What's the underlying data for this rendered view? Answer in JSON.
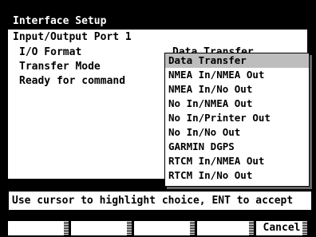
{
  "window": {
    "title": "Interface Setup",
    "port_label": "Input/Output Port 1",
    "options": [
      {
        "label": "I/O Format",
        "value": "Data Transfer"
      },
      {
        "label": "Transfer Mode"
      },
      {
        "label": "Ready for command"
      }
    ]
  },
  "menu": {
    "selected_index": 0,
    "items": [
      "Data Transfer",
      "NMEA In/NMEA Out",
      "NMEA In/No Out",
      "No In/NMEA Out",
      "No In/Printer Out",
      "No In/No Out",
      "GARMIN DGPS",
      "RTCM In/NMEA Out",
      "RTCM In/No Out"
    ]
  },
  "hint": "Use cursor to highlight choice, ENT to accept",
  "softkeys": [
    "",
    "",
    "",
    "",
    "Cancel"
  ]
}
